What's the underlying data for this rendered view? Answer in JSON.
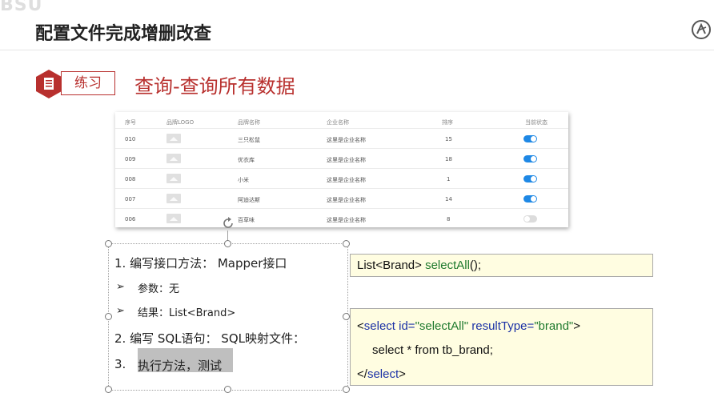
{
  "watermark": "BSU",
  "slide": {
    "title": "配置文件完成增删改查"
  },
  "section": {
    "badge_label": "练习",
    "heading": "查询-查询所有数据"
  },
  "table": {
    "headers": [
      "序号",
      "品牌LOGO",
      "品牌名称",
      "企业名称",
      "排序",
      "当前状态"
    ],
    "rows": [
      {
        "id": "010",
        "brand": "三只松鼠",
        "company": "这里是企业名称",
        "order": "15",
        "status": true
      },
      {
        "id": "009",
        "brand": "优衣库",
        "company": "这里是企业名称",
        "order": "18",
        "status": true
      },
      {
        "id": "008",
        "brand": "小米",
        "company": "这里是企业名称",
        "order": "1",
        "status": true
      },
      {
        "id": "007",
        "brand": "阿迪达斯",
        "company": "这里是企业名称",
        "order": "14",
        "status": true
      },
      {
        "id": "006",
        "brand": "百草味",
        "company": "这里是企业名称",
        "order": "8",
        "status": false
      }
    ]
  },
  "steps": {
    "step1": "1.  编写接口方法： Mapper接口",
    "bullet_mark": "➢",
    "param": "参数：无",
    "result": "结果：List<Brand>",
    "step2": "2.  编写 SQL语句： SQL映射文件：",
    "step3_num": "3.",
    "step3_text": "执行方法，测试"
  },
  "code1": {
    "type": "List<Brand> ",
    "method": "selectAll",
    "rest": "();"
  },
  "code2": {
    "tag_open": "<",
    "tag_name": "select",
    "attr_id": " id=",
    "id_val": "\"selectAll\"",
    "attr_rt": " resultType=",
    "rt_val": "\"brand\"",
    "tag_close": ">",
    "body": "select * from tb_brand;",
    "end_open": "</",
    "end_name": "select",
    "end_close": ">"
  },
  "colors": {
    "accent": "#b8302e",
    "toggle_on": "#1e88e5",
    "code_bg": "#fffde1"
  }
}
